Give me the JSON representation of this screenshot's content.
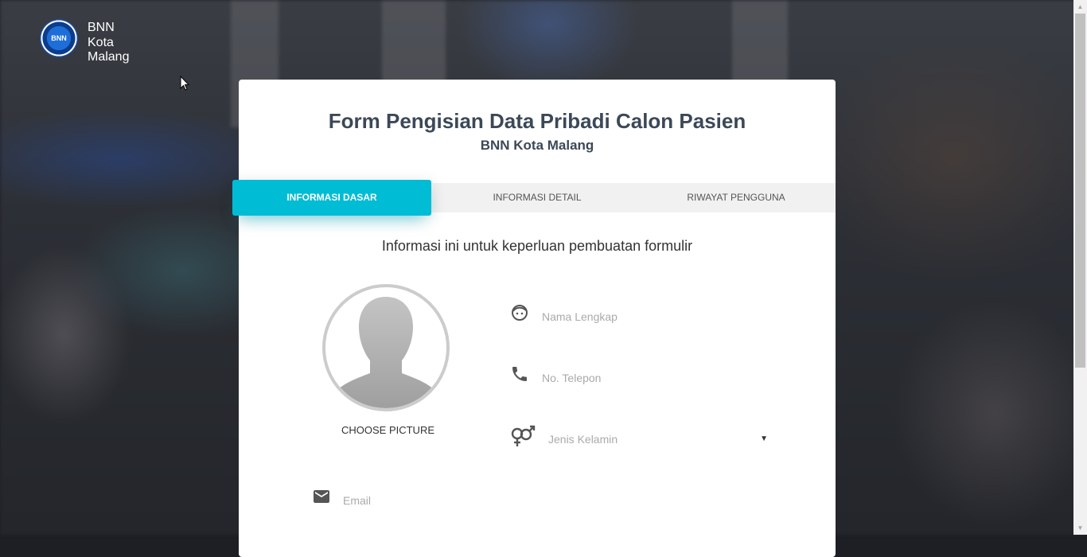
{
  "brand": {
    "logo_text": "BNN",
    "name_lines": [
      "BNN",
      "Kota",
      "Malang"
    ]
  },
  "form": {
    "title": "Form Pengisian Data Pribadi Calon Pasien",
    "subtitle": "BNN Kota Malang",
    "tabs": [
      {
        "label": "INFORMASI DASAR",
        "active": true
      },
      {
        "label": "INFORMASI DETAIL",
        "active": false
      },
      {
        "label": "RIWAYAT PENGGUNA",
        "active": false
      }
    ],
    "info_text": "Informasi ini untuk keperluan pembuatan formulir",
    "choose_picture": "CHOOSE PICTURE",
    "fields": {
      "nama": {
        "placeholder": "Nama Lengkap",
        "value": "",
        "icon": "face-icon"
      },
      "telepon": {
        "placeholder": "No. Telepon",
        "value": "",
        "icon": "phone-icon"
      },
      "kelamin": {
        "placeholder": "Jenis Kelamin",
        "value": "",
        "icon": "gender-icon"
      },
      "email": {
        "placeholder": "Email",
        "value": "",
        "icon": "mail-icon"
      }
    }
  },
  "colors": {
    "accent": "#00bcd4",
    "title": "#3c4858"
  }
}
